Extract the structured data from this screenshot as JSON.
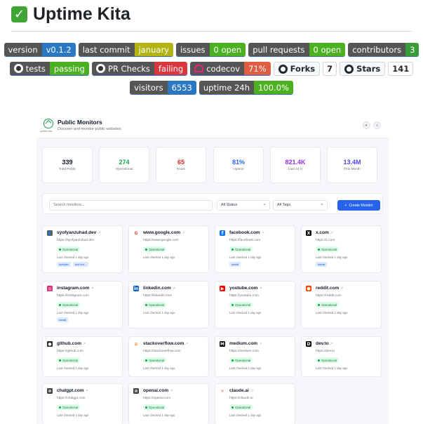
{
  "readme": {
    "title": "Uptime Kita",
    "title_emoji": "✓"
  },
  "badges_row1": [
    {
      "left": "version",
      "right": "v0.1.2",
      "color": "#2a78c2"
    },
    {
      "left": "last commit",
      "right": "january",
      "color": "#b3b312"
    },
    {
      "left": "issues",
      "right": "0 open",
      "color": "#4cb120"
    },
    {
      "left": "pull requests",
      "right": "0 open",
      "color": "#4cb120"
    },
    {
      "left": "contributors",
      "right": "3",
      "color": "#3a9b3a"
    }
  ],
  "badges_row2": {
    "tests": {
      "left": "tests",
      "right": "passing"
    },
    "pr_checks": {
      "left": "PR Checks",
      "right": "failing"
    },
    "codecov": {
      "left": "codecov",
      "right": "71%"
    },
    "forks": {
      "label": "Forks",
      "count": "7"
    },
    "stars": {
      "label": "Stars",
      "count": "141"
    }
  },
  "badges_row3": {
    "visitors": {
      "left": "visitors",
      "right": "6553"
    },
    "uptime": {
      "left": "uptime 24h",
      "right": "100.0%"
    }
  },
  "app": {
    "logo_caption": "uptime kita",
    "title": "Public Monitors",
    "subtitle": "Discover and monitor public websites",
    "theme_icon": "◐",
    "home_icon": "⌂",
    "stats": [
      {
        "value": "339",
        "label": "Total Public",
        "color": "#111827"
      },
      {
        "value": "274",
        "label": "Operational",
        "color": "#16a34a"
      },
      {
        "value": "65",
        "label": "Down",
        "color": "#dc2626"
      },
      {
        "value": "81%",
        "label": "Uptime",
        "color": "#2563eb"
      },
      {
        "value": "821.4K",
        "label": "Last 24 H",
        "color": "#9333ea"
      },
      {
        "value": "13.4M",
        "label": "This Month",
        "color": "#4f46e5"
      }
    ],
    "search_placeholder": "Search monitors...",
    "status_filter": "All Status",
    "tags_filter": "All Tags",
    "create_button": "Create Monitor",
    "status_label": "Operational",
    "last_checked": "Last checked 1 day ago",
    "monitors": [
      {
        "name": "syofyanzuhad.dev",
        "url": "https://syofyanzuhad.dev",
        "icon": "👤",
        "icon_color": "#6b5b45",
        "tags": [
          "syofyan",
          "tool ton..."
        ]
      },
      {
        "name": "www.google.com",
        "url": "https://www.google.com",
        "icon": "G",
        "icon_color": "#ea4335",
        "tags": []
      },
      {
        "name": "facebook.com",
        "url": "https://facebook.com",
        "icon": "f",
        "icon_color": "#1877f2",
        "tags": [
          "social"
        ]
      },
      {
        "name": "x.com",
        "url": "https://x.com",
        "icon": "X",
        "icon_color": "#000000",
        "tags": [
          "social"
        ]
      },
      {
        "name": "instagram.com",
        "url": "https://instagram.com",
        "icon": "◎",
        "icon_color": "#d62976",
        "tags": [
          "social"
        ]
      },
      {
        "name": "linkedin.com",
        "url": "https://linkedin.com",
        "icon": "in",
        "icon_color": "#0a66c2",
        "tags": []
      },
      {
        "name": "youtube.com",
        "url": "https://youtube.com",
        "icon": "▶",
        "icon_color": "#ff0000",
        "tags": []
      },
      {
        "name": "reddit.com",
        "url": "https://reddit.com",
        "icon": "●",
        "icon_color": "#ff4500",
        "tags": []
      },
      {
        "name": "github.com",
        "url": "https://github.com",
        "icon": "●",
        "icon_color": "#24292f",
        "tags": []
      },
      {
        "name": "stackoverflow.com",
        "url": "https://stackoverflow.com",
        "icon": "≡",
        "icon_color": "#f48024",
        "tags": []
      },
      {
        "name": "medium.com",
        "url": "https://medium.com",
        "icon": "M",
        "icon_color": "#000000",
        "tags": []
      },
      {
        "name": "dev.to",
        "url": "https://dev.to",
        "icon": "D",
        "icon_color": "#0a0a0a",
        "tags": []
      },
      {
        "name": "chatgpt.com",
        "url": "https://chatgpt.com",
        "icon": "✻",
        "icon_color": "#444444",
        "tags": []
      },
      {
        "name": "openai.com",
        "url": "https://openai.com",
        "icon": "✻",
        "icon_color": "#444444",
        "tags": []
      },
      {
        "name": "claude.ai",
        "url": "https://claude.ai",
        "icon": "✳",
        "icon_color": "#d97757",
        "tags": []
      }
    ]
  }
}
